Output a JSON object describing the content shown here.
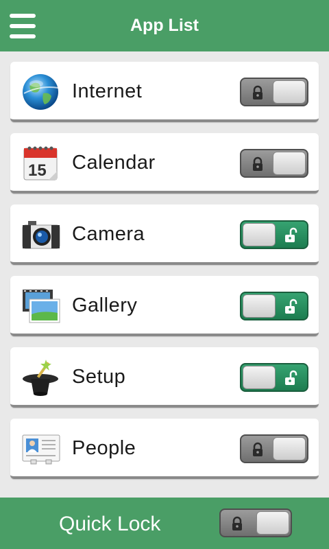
{
  "header": {
    "title": "App List",
    "menu_icon": "hamburger-menu-icon",
    "background": "#4a9e66"
  },
  "apps": [
    {
      "label": "Internet",
      "icon": "globe-icon",
      "state": "locked"
    },
    {
      "label": "Calendar",
      "icon": "calendar-icon",
      "calendar_day": "15",
      "state": "locked"
    },
    {
      "label": "Camera",
      "icon": "camera-icon",
      "state": "unlocked"
    },
    {
      "label": "Gallery",
      "icon": "gallery-icon",
      "state": "unlocked"
    },
    {
      "label": "Setup",
      "icon": "magic-hat-icon",
      "state": "unlocked"
    },
    {
      "label": "People",
      "icon": "contact-card-icon",
      "state": "locked"
    }
  ],
  "footer": {
    "label": "Quick Lock",
    "state": "locked"
  },
  "colors": {
    "accent_green": "#4a9e66",
    "unlocked_green": "#2a9060",
    "locked_gray": "#7a7a7a"
  }
}
